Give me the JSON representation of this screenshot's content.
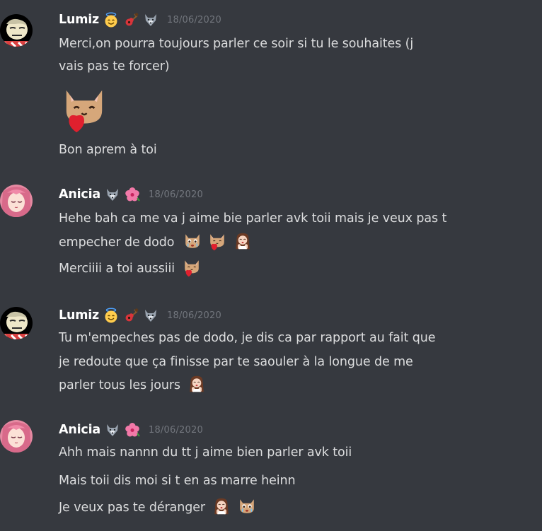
{
  "messages": [
    {
      "author": "Lumiz",
      "badges": [
        "innocent-face",
        "guitar",
        "wolf"
      ],
      "timestamp": "18/06/2020",
      "lines": [
        "Merci,on pourra toujours parler ce soir si tu le souhaites (j",
        "vais pas te forcer)",
        "Bon aprem à toi"
      ]
    },
    {
      "author": "Anicia",
      "badges": [
        "wolf",
        "hibiscus"
      ],
      "timestamp": "18/06/2020",
      "lines": [
        "Hehe bah ca me va j aime bie  parler avk toii mais je veux pas t",
        "empecher de dodo",
        "Merciiii a toi aussiii"
      ]
    },
    {
      "author": "Lumiz",
      "badges": [
        "innocent-face",
        "guitar",
        "wolf"
      ],
      "timestamp": "18/06/2020",
      "lines": [
        "Tu m'empeches pas de dodo, je dis ca par rapport au fait que",
        "je redoute que ça finisse par te saouler à la longue de me",
        "parler tous les jours"
      ]
    },
    {
      "author": "Anicia",
      "badges": [
        "wolf",
        "hibiscus"
      ],
      "timestamp": "18/06/2020",
      "lines": [
        "Ahh mais nannn du tt j aime bien parler avk toii",
        "Mais toii dis moi si t en as marre heinn",
        "Je veux pas te déranger"
      ]
    }
  ],
  "colors": {
    "background": "#36393f",
    "username": "#ffffff",
    "message_text": "#dcddde",
    "timestamp": "#72767d"
  }
}
